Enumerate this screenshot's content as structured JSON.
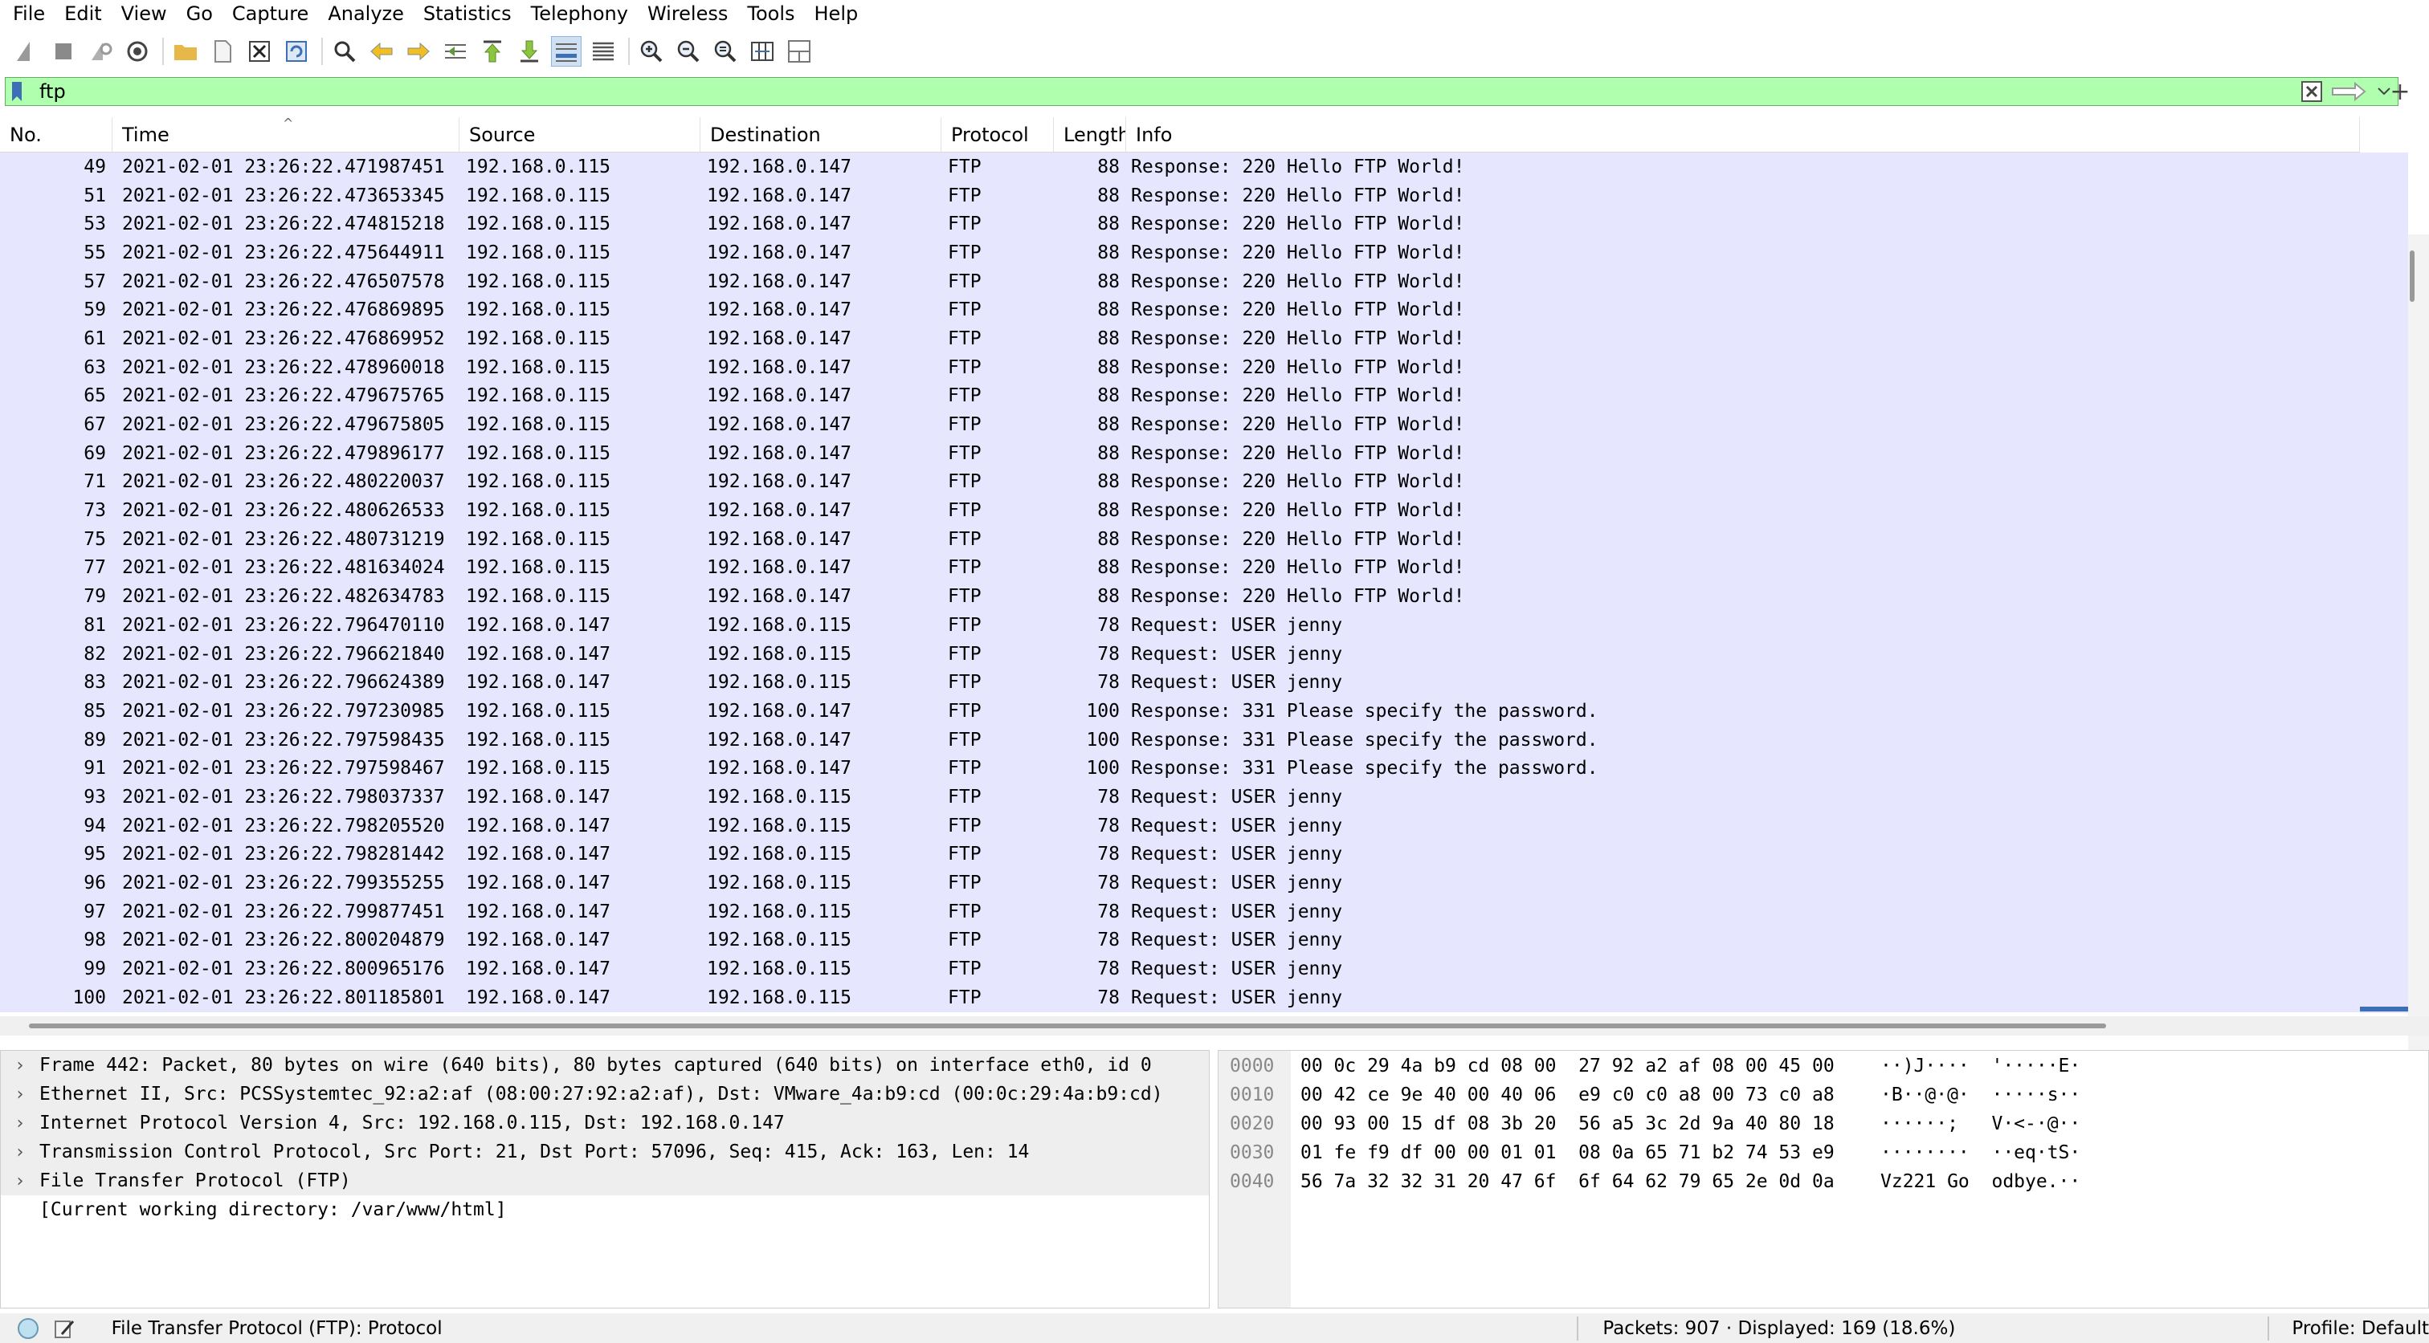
{
  "menu": [
    "File",
    "Edit",
    "View",
    "Go",
    "Capture",
    "Analyze",
    "Statistics",
    "Telephony",
    "Wireless",
    "Tools",
    "Help"
  ],
  "filter": {
    "value": "ftp",
    "bg_color": "#afffaf"
  },
  "columns": [
    "No.",
    "Time",
    "Source",
    "Destination",
    "Protocol",
    "Length",
    "Info"
  ],
  "packets": [
    [
      "49",
      "2021-02-01 23:26:22.471987451",
      "192.168.0.115",
      "192.168.0.147",
      "FTP",
      "88",
      "Response: 220 Hello FTP World!"
    ],
    [
      "51",
      "2021-02-01 23:26:22.473653345",
      "192.168.0.115",
      "192.168.0.147",
      "FTP",
      "88",
      "Response: 220 Hello FTP World!"
    ],
    [
      "53",
      "2021-02-01 23:26:22.474815218",
      "192.168.0.115",
      "192.168.0.147",
      "FTP",
      "88",
      "Response: 220 Hello FTP World!"
    ],
    [
      "55",
      "2021-02-01 23:26:22.475644911",
      "192.168.0.115",
      "192.168.0.147",
      "FTP",
      "88",
      "Response: 220 Hello FTP World!"
    ],
    [
      "57",
      "2021-02-01 23:26:22.476507578",
      "192.168.0.115",
      "192.168.0.147",
      "FTP",
      "88",
      "Response: 220 Hello FTP World!"
    ],
    [
      "59",
      "2021-02-01 23:26:22.476869895",
      "192.168.0.115",
      "192.168.0.147",
      "FTP",
      "88",
      "Response: 220 Hello FTP World!"
    ],
    [
      "61",
      "2021-02-01 23:26:22.476869952",
      "192.168.0.115",
      "192.168.0.147",
      "FTP",
      "88",
      "Response: 220 Hello FTP World!"
    ],
    [
      "63",
      "2021-02-01 23:26:22.478960018",
      "192.168.0.115",
      "192.168.0.147",
      "FTP",
      "88",
      "Response: 220 Hello FTP World!"
    ],
    [
      "65",
      "2021-02-01 23:26:22.479675765",
      "192.168.0.115",
      "192.168.0.147",
      "FTP",
      "88",
      "Response: 220 Hello FTP World!"
    ],
    [
      "67",
      "2021-02-01 23:26:22.479675805",
      "192.168.0.115",
      "192.168.0.147",
      "FTP",
      "88",
      "Response: 220 Hello FTP World!"
    ],
    [
      "69",
      "2021-02-01 23:26:22.479896177",
      "192.168.0.115",
      "192.168.0.147",
      "FTP",
      "88",
      "Response: 220 Hello FTP World!"
    ],
    [
      "71",
      "2021-02-01 23:26:22.480220037",
      "192.168.0.115",
      "192.168.0.147",
      "FTP",
      "88",
      "Response: 220 Hello FTP World!"
    ],
    [
      "73",
      "2021-02-01 23:26:22.480626533",
      "192.168.0.115",
      "192.168.0.147",
      "FTP",
      "88",
      "Response: 220 Hello FTP World!"
    ],
    [
      "75",
      "2021-02-01 23:26:22.480731219",
      "192.168.0.115",
      "192.168.0.147",
      "FTP",
      "88",
      "Response: 220 Hello FTP World!"
    ],
    [
      "77",
      "2021-02-01 23:26:22.481634024",
      "192.168.0.115",
      "192.168.0.147",
      "FTP",
      "88",
      "Response: 220 Hello FTP World!"
    ],
    [
      "79",
      "2021-02-01 23:26:22.482634783",
      "192.168.0.115",
      "192.168.0.147",
      "FTP",
      "88",
      "Response: 220 Hello FTP World!"
    ],
    [
      "81",
      "2021-02-01 23:26:22.796470110",
      "192.168.0.147",
      "192.168.0.115",
      "FTP",
      "78",
      "Request: USER jenny"
    ],
    [
      "82",
      "2021-02-01 23:26:22.796621840",
      "192.168.0.147",
      "192.168.0.115",
      "FTP",
      "78",
      "Request: USER jenny"
    ],
    [
      "83",
      "2021-02-01 23:26:22.796624389",
      "192.168.0.147",
      "192.168.0.115",
      "FTP",
      "78",
      "Request: USER jenny"
    ],
    [
      "85",
      "2021-02-01 23:26:22.797230985",
      "192.168.0.115",
      "192.168.0.147",
      "FTP",
      "100",
      "Response: 331 Please specify the password."
    ],
    [
      "89",
      "2021-02-01 23:26:22.797598435",
      "192.168.0.115",
      "192.168.0.147",
      "FTP",
      "100",
      "Response: 331 Please specify the password."
    ],
    [
      "91",
      "2021-02-01 23:26:22.797598467",
      "192.168.0.115",
      "192.168.0.147",
      "FTP",
      "100",
      "Response: 331 Please specify the password."
    ],
    [
      "93",
      "2021-02-01 23:26:22.798037337",
      "192.168.0.147",
      "192.168.0.115",
      "FTP",
      "78",
      "Request: USER jenny"
    ],
    [
      "94",
      "2021-02-01 23:26:22.798205520",
      "192.168.0.147",
      "192.168.0.115",
      "FTP",
      "78",
      "Request: USER jenny"
    ],
    [
      "95",
      "2021-02-01 23:26:22.798281442",
      "192.168.0.147",
      "192.168.0.115",
      "FTP",
      "78",
      "Request: USER jenny"
    ],
    [
      "96",
      "2021-02-01 23:26:22.799355255",
      "192.168.0.147",
      "192.168.0.115",
      "FTP",
      "78",
      "Request: USER jenny"
    ],
    [
      "97",
      "2021-02-01 23:26:22.799877451",
      "192.168.0.147",
      "192.168.0.115",
      "FTP",
      "78",
      "Request: USER jenny"
    ],
    [
      "98",
      "2021-02-01 23:26:22.800204879",
      "192.168.0.147",
      "192.168.0.115",
      "FTP",
      "78",
      "Request: USER jenny"
    ],
    [
      "99",
      "2021-02-01 23:26:22.800965176",
      "192.168.0.147",
      "192.168.0.115",
      "FTP",
      "78",
      "Request: USER jenny"
    ],
    [
      "100",
      "2021-02-01 23:26:22.801185801",
      "192.168.0.147",
      "192.168.0.115",
      "FTP",
      "78",
      "Request: USER jenny"
    ]
  ],
  "details": [
    {
      "text": "Frame 442: Packet, 80 bytes on wire (640 bits), 80 bytes captured (640 bits) on interface eth0, id 0",
      "expandable": true
    },
    {
      "text": "Ethernet II, Src: PCSSystemtec_92:a2:af (08:00:27:92:a2:af), Dst: VMware_4a:b9:cd (00:0c:29:4a:b9:cd)",
      "expandable": true
    },
    {
      "text": "Internet Protocol Version 4, Src: 192.168.0.115, Dst: 192.168.0.147",
      "expandable": true
    },
    {
      "text": "Transmission Control Protocol, Src Port: 21, Dst Port: 57096, Seq: 415, Ack: 163, Len: 14",
      "expandable": true
    },
    {
      "text": "File Transfer Protocol (FTP)",
      "expandable": true
    },
    {
      "text": "[Current working directory: /var/www/html]",
      "expandable": false
    }
  ],
  "hex": [
    {
      "offset": "0000",
      "bytes": "00 0c 29 4a b9 cd 08 00  27 92 a2 af 08 00 45 00",
      "ascii": "··)J····  '·····E·"
    },
    {
      "offset": "0010",
      "bytes": "00 42 ce 9e 40 00 40 06  e9 c0 c0 a8 00 73 c0 a8",
      "ascii": "·B··@·@·  ·····s··"
    },
    {
      "offset": "0020",
      "bytes": "00 93 00 15 df 08 3b 20  56 a5 3c 2d 9a 40 80 18",
      "ascii": "······;   V·<-·@··"
    },
    {
      "offset": "0030",
      "bytes": "01 fe f9 df 00 00 01 01  08 0a 65 71 b2 74 53 e9",
      "ascii": "········  ··eq·tS·"
    },
    {
      "offset": "0040",
      "bytes": "56 7a 32 32 31 20 47 6f  6f 64 62 79 65 2e 0d 0a",
      "ascii": "Vz221 Go  odbye.··"
    }
  ],
  "status": {
    "main": "File Transfer Protocol (FTP): Protocol",
    "packets": "Packets: 907 · Displayed: 169 (18.6%)",
    "profile": "Profile: Default"
  },
  "colors": {
    "row_bg": "#e7e6ff",
    "filter_ok": "#afffaf",
    "accent": "#3c6fb5"
  }
}
